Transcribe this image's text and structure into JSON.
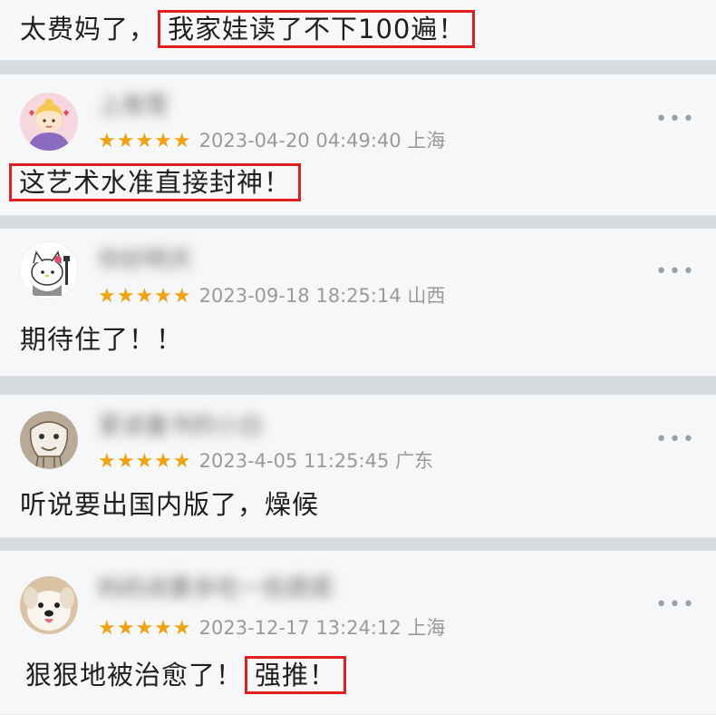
{
  "top": {
    "prefix": "太费妈了，",
    "highlight": "我家娃读了不下100遍！"
  },
  "reviews": [
    {
      "name": "上南雪",
      "stars": "★★★★★",
      "date": "2023-04-20 04:49:40",
      "location": "上海",
      "text": "",
      "highlight": "这艺术水准直接封神！"
    },
    {
      "name": "你好明天",
      "stars": "★★★★★",
      "date": "2023-09-18",
      "time": "18:25:14",
      "location": "山西",
      "text": "期待住了！！"
    },
    {
      "name": "爱读童书的小白",
      "stars": "★★★★★",
      "date": "2023-4-05",
      "time": "11:25:45",
      "location": "广东",
      "text": "听说要出国内版了，燥候"
    },
    {
      "name": "妈妈说要多吃一些蔬菜",
      "stars": "★★★★★",
      "date": "2023-12-17",
      "time": "13:24:12",
      "location": "上海",
      "text": "狠狠地被治愈了！",
      "highlight": "强推！"
    }
  ],
  "more_icon": "more-dots-icon",
  "colors": {
    "highlight_border": "#e0201f",
    "star": "#f2a20f"
  }
}
